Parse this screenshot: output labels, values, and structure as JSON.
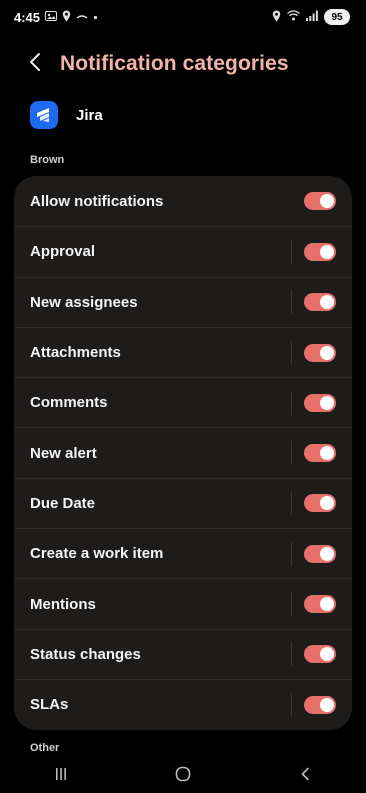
{
  "status_bar": {
    "time": "4:45",
    "battery": "95",
    "left_icons": [
      "gallery-icon",
      "location-icon",
      "cloud-icon",
      "dot-icon"
    ],
    "right_icons": [
      "location-icon",
      "wifi-icon",
      "signal-icon"
    ]
  },
  "header": {
    "title": "Notification categories"
  },
  "app": {
    "name": "Jira",
    "icon": "jira-icon",
    "icon_color": "#1e6bf0"
  },
  "sections": {
    "brown": "Brown",
    "other": "Other"
  },
  "accent": "#e7706b",
  "items": [
    {
      "label": "Allow notifications",
      "on": true,
      "divider": false
    },
    {
      "label": "Approval",
      "on": true,
      "divider": true
    },
    {
      "label": "New assignees",
      "on": true,
      "divider": true
    },
    {
      "label": "Attachments",
      "on": true,
      "divider": true
    },
    {
      "label": "Comments",
      "on": true,
      "divider": true
    },
    {
      "label": "New alert",
      "on": true,
      "divider": true
    },
    {
      "label": "Due Date",
      "on": true,
      "divider": true
    },
    {
      "label": "Create a work item",
      "on": true,
      "divider": true
    },
    {
      "label": "Mentions",
      "on": true,
      "divider": true
    },
    {
      "label": "Status changes",
      "on": true,
      "divider": true
    },
    {
      "label": "SLAs",
      "on": true,
      "divider": true
    }
  ],
  "nav": [
    "recents-icon",
    "home-icon",
    "back-icon"
  ]
}
